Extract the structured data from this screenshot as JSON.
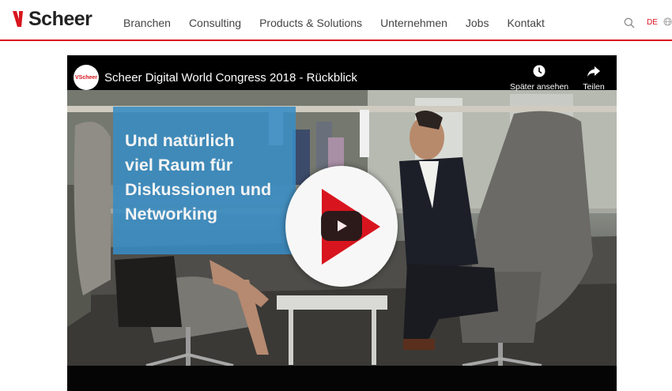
{
  "header": {
    "logo_text": "Scheer",
    "nav": [
      "Branchen",
      "Consulting",
      "Products & Solutions",
      "Unternehmen",
      "Jobs",
      "Kontakt"
    ],
    "language": "DE",
    "icons": [
      "search-icon",
      "globe-icon"
    ],
    "accent_color": "#d8151e"
  },
  "video": {
    "channel_avatar_text": "VScheer",
    "title": "Scheer Digital World Congress 2018 - Rückblick",
    "watch_later_label": "Später ansehen",
    "share_label": "Teilen",
    "caption_lines": [
      "Und natürlich",
      "viel Raum für",
      "Diskussionen und",
      "Networking"
    ],
    "caption_color": "#388cc4",
    "icons": [
      "clock-icon",
      "share-icon",
      "play-icon"
    ]
  }
}
